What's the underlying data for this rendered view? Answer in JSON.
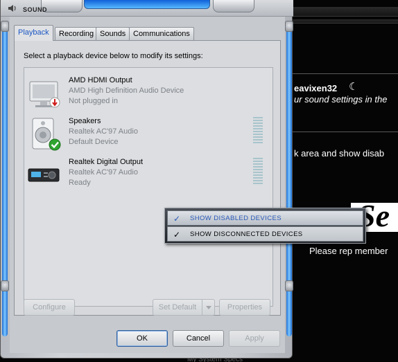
{
  "window": {
    "title": "SOUND"
  },
  "tabs": [
    "Playback",
    "Recording",
    "Sounds",
    "Communications"
  ],
  "instructions": "Select a playback device below to modify its settings:",
  "devices": [
    {
      "name": "AMD HDMI Output",
      "line1": "AMD High Definition Audio Device",
      "line2": "Not plugged in",
      "icon": "monitor-icon",
      "badge": "not-plugged-in-icon"
    },
    {
      "name": "Speakers",
      "line1": "Realtek AC'97 Audio",
      "line2": "Default Device",
      "icon": "speaker-icon",
      "badge": "default-check-icon"
    },
    {
      "name": "Realtek Digital Output",
      "line1": "Realtek AC'97 Audio",
      "line2": "Ready",
      "icon": "digital-receiver-icon"
    }
  ],
  "buttons": {
    "configure": "Configure",
    "set_default": "Set Default",
    "properties": "Properties",
    "ok": "OK",
    "cancel": "Cancel",
    "apply": "Apply"
  },
  "context_menu": [
    {
      "label": "SHOW DISABLED DEVICES",
      "checked": true
    },
    {
      "label": "SHOW DISCONNECTED DEVICES",
      "checked": true
    }
  ],
  "background": {
    "username": "eavixen32",
    "line1": "ur sound settings in the",
    "line2": "k area and show disab",
    "line3": "Please rep member",
    "footer": "My System Specs"
  },
  "colors": {
    "accent": "#1c56c4",
    "chrome_blue": "#1d6fd6",
    "menu_hover_text": "#2a59b8"
  }
}
